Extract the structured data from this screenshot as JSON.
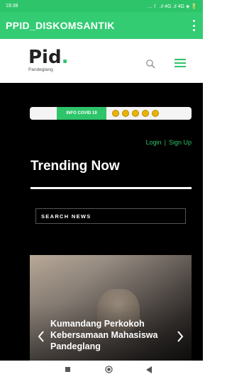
{
  "status": {
    "time": "19:38",
    "right": "… ☾ .ıl 4G .ıl 4G ◈ 🔋"
  },
  "appbar": {
    "title": "PPID_DISKOMSANTIK"
  },
  "site": {
    "logo_mark": "Pid",
    "logo_sub": "Pandeglang"
  },
  "ticker": {
    "badge": "INFO COVID 19"
  },
  "auth": {
    "login": "Login",
    "separator": "|",
    "signup": "Sign Up"
  },
  "section": {
    "title": "Trending Now"
  },
  "search": {
    "placeholder": "SEARCH NEWS"
  },
  "slide": {
    "headline": "Kumandang Perkokoh Kebersamaan Mahasiswa Pandeglang"
  },
  "colors": {
    "accent": "#2ec46a",
    "appbar": "#33cc73",
    "dark": "#000000"
  }
}
